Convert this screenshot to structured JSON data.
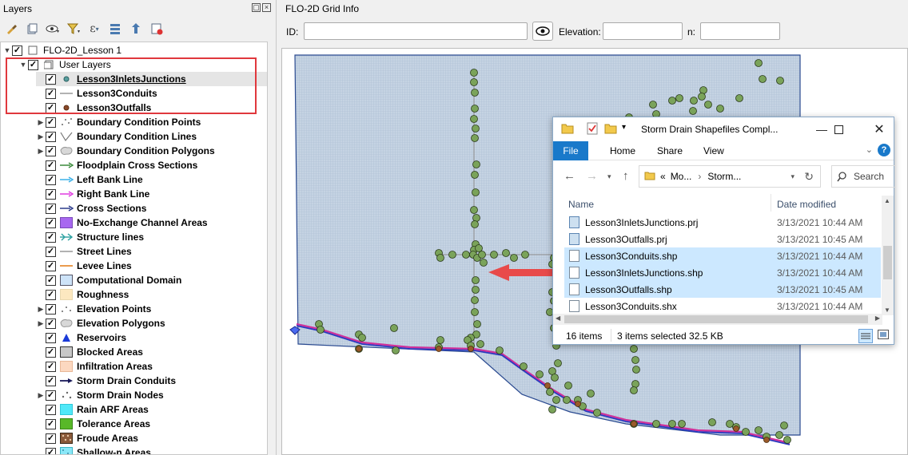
{
  "layers_panel": {
    "title": "Layers",
    "toolbar_icons": [
      "paint-brush-icon",
      "add-group-icon",
      "eye-manage-icon",
      "filter-icon",
      "expression-filter-icon",
      "expand-all-icon",
      "collapse-all-icon",
      "remove-layer-icon"
    ],
    "project": "FLO-2D_Lesson 1",
    "group": "User Layers",
    "layers": [
      {
        "label": "Lesson3InletsJunctions",
        "symbol": "dot-teal",
        "checked": true,
        "selected": true,
        "underline": true
      },
      {
        "label": "Lesson3Conduits",
        "symbol": "line-gray",
        "checked": true
      },
      {
        "label": "Lesson3Outfalls",
        "symbol": "dot-brown",
        "checked": true
      },
      {
        "label": "Boundary Condition Points",
        "symbol": "bc-points",
        "checked": true,
        "expander": true
      },
      {
        "label": "Boundary Condition Lines",
        "symbol": "bc-lines",
        "checked": true,
        "expander": true
      },
      {
        "label": "Boundary Condition Polygons",
        "symbol": "bc-poly",
        "checked": true,
        "expander": true
      },
      {
        "label": "Floodplain Cross Sections",
        "symbol": "arrow-green",
        "checked": true
      },
      {
        "label": "Left Bank Line",
        "symbol": "arrow-cyan",
        "checked": true
      },
      {
        "label": "Right Bank Line",
        "symbol": "arrow-magenta",
        "checked": true
      },
      {
        "label": "Cross Sections",
        "symbol": "arrow-navy",
        "checked": true
      },
      {
        "label": "No-Exchange Channel Areas",
        "symbol": "fill-purple",
        "checked": true
      },
      {
        "label": "Structure lines",
        "symbol": "structure-teal",
        "checked": true
      },
      {
        "label": "Street Lines",
        "symbol": "line-gray",
        "checked": true
      },
      {
        "label": "Levee Lines",
        "symbol": "line-orange",
        "checked": true
      },
      {
        "label": "Computational Domain",
        "symbol": "fill-lightblue",
        "checked": true
      },
      {
        "label": "Roughness",
        "symbol": "fill-cream",
        "checked": true
      },
      {
        "label": "Elevation Points",
        "symbol": "elev-points",
        "checked": true,
        "expander": true
      },
      {
        "label": "Elevation Polygons",
        "symbol": "bc-poly",
        "checked": true,
        "expander": true
      },
      {
        "label": "Reservoirs",
        "symbol": "triangle-blue",
        "checked": true
      },
      {
        "label": "Blocked Areas",
        "symbol": "fill-gray",
        "checked": true
      },
      {
        "label": "Infiltration Areas",
        "symbol": "fill-peach",
        "checked": true
      },
      {
        "label": "Storm Drain Conduits",
        "symbol": "arrow-darknavy",
        "checked": true
      },
      {
        "label": "Storm Drain Nodes",
        "symbol": "sd-nodes",
        "checked": true,
        "expander": true
      },
      {
        "label": "Rain ARF Areas",
        "symbol": "fill-cyan",
        "checked": true
      },
      {
        "label": "Tolerance Areas",
        "symbol": "fill-green",
        "checked": true
      },
      {
        "label": "Froude Areas",
        "symbol": "fill-brown-pattern",
        "checked": true
      },
      {
        "label": "Shallow-n Areas",
        "symbol": "fill-cyan-pattern",
        "checked": true
      }
    ],
    "colors": {
      "highlight": "#e0383d"
    }
  },
  "grid_info": {
    "title": "FLO-2D Grid Info",
    "id_label": "ID:",
    "elevation_label": "Elevation:",
    "n_label": "n:",
    "id_value": "",
    "elevation_value": "",
    "n_value": ""
  },
  "explorer": {
    "title": "Storm Drain Shapefiles Compl...",
    "tabs": {
      "file": "File",
      "home": "Home",
      "share": "Share",
      "view": "View"
    },
    "address": {
      "prefix": "«",
      "part1": "Mo...",
      "sep": "›",
      "part2": "Storm..."
    },
    "search_placeholder": "Search",
    "columns": {
      "name": "Name",
      "date": "Date modified"
    },
    "files": [
      {
        "name": "Lesson3InletsJunctions.prj",
        "date": "3/13/2021 10:44 AM",
        "selected": false,
        "type": "prj"
      },
      {
        "name": "Lesson3Outfalls.prj",
        "date": "3/13/2021 10:45 AM",
        "selected": false,
        "type": "prj"
      },
      {
        "name": "Lesson3Conduits.shp",
        "date": "3/13/2021 10:44 AM",
        "selected": true,
        "type": "file"
      },
      {
        "name": "Lesson3InletsJunctions.shp",
        "date": "3/13/2021 10:44 AM",
        "selected": true,
        "type": "file"
      },
      {
        "name": "Lesson3Outfalls.shp",
        "date": "3/13/2021 10:45 AM",
        "selected": true,
        "type": "file"
      },
      {
        "name": "Lesson3Conduits.shx",
        "date": "3/13/2021 10:44 AM",
        "selected": false,
        "type": "file"
      }
    ],
    "status": {
      "items": "16 items",
      "selected": "3 items selected  32.5 KB"
    }
  }
}
